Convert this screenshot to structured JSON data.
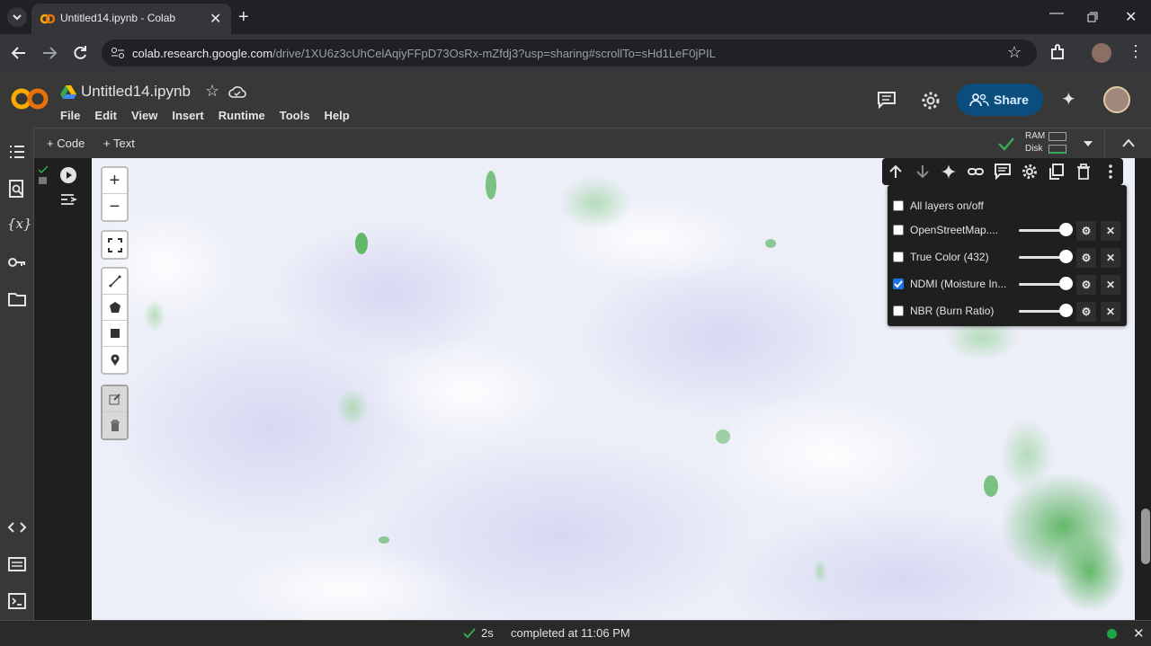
{
  "browser": {
    "tab_title": "Untitled14.ipynb - Colab",
    "url_host": "colab.research.google.com",
    "url_path": "/drive/1XU6z3cUhCelAqiyFFpD73OsRx-mZfdj3?usp=sharing#scrollTo=sHd1LeF0jPIL"
  },
  "colab": {
    "notebook_title": "Untitled14.ipynb",
    "menu": [
      "File",
      "Edit",
      "View",
      "Insert",
      "Runtime",
      "Tools",
      "Help"
    ],
    "share_label": "Share",
    "add_code_label": "Code",
    "add_text_label": "Text",
    "ram_label": "RAM",
    "disk_label": "Disk"
  },
  "layers": {
    "toggle_all_label": "All layers on/off",
    "items": [
      {
        "name": "OpenStreetMap....",
        "checked": false,
        "opacity": 1.0
      },
      {
        "name": "True Color (432)",
        "checked": false,
        "opacity": 1.0
      },
      {
        "name": "NDMI (Moisture In...",
        "checked": true,
        "opacity": 1.0
      },
      {
        "name": "NBR (Burn Ratio)",
        "checked": false,
        "opacity": 1.0
      }
    ]
  },
  "status": {
    "duration": "2s",
    "message": "completed at 11:06 PM"
  },
  "colors": {
    "accent": "#1a73e8",
    "share_bg": "#0b4d7d",
    "ok_green": "#34a853",
    "colab_orange": "#f9ab00"
  }
}
